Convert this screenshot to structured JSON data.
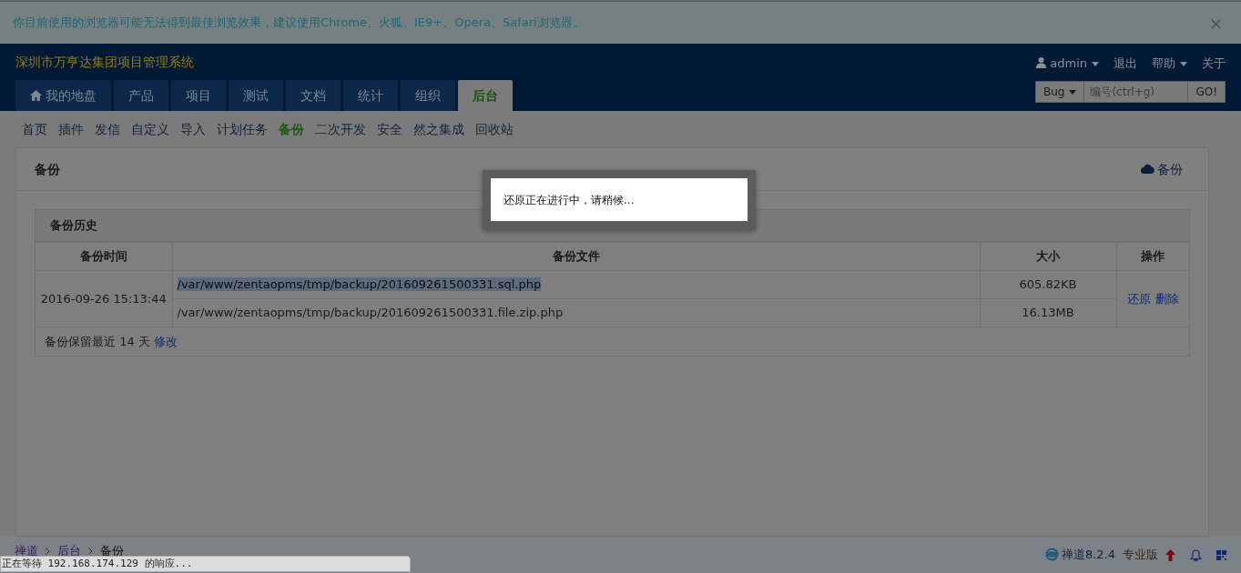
{
  "alert": {
    "text": "你目前使用的浏览器可能无法得到最佳浏览效果，建议使用Chrome、火狐、IE9+、Opera、Safari浏览器。",
    "close": "×"
  },
  "header": {
    "brand": "深圳市万亨达集团项目管理系统",
    "user": "admin",
    "links": [
      {
        "label": "退出",
        "dropdown": false
      },
      {
        "label": "帮助",
        "dropdown": true
      },
      {
        "label": "关于",
        "dropdown": false
      }
    ],
    "search": {
      "type": "Bug",
      "placeholder": "编号(ctrl+g)",
      "button": "GO!"
    }
  },
  "tabs": [
    {
      "label": "我的地盘",
      "kind": "home",
      "selected": false
    },
    {
      "label": "产品",
      "kind": "plain",
      "selected": false
    },
    {
      "label": "项目",
      "kind": "plain",
      "selected": false
    },
    {
      "label": "测试",
      "kind": "plain",
      "selected": false
    },
    {
      "label": "文档",
      "kind": "plain",
      "selected": false
    },
    {
      "label": "统计",
      "kind": "plain",
      "selected": false
    },
    {
      "label": "组织",
      "kind": "plain",
      "selected": false
    },
    {
      "label": "后台",
      "kind": "plain",
      "selected": true
    }
  ],
  "subnav": [
    {
      "label": "首页",
      "selected": false
    },
    {
      "label": "插件",
      "selected": false
    },
    {
      "label": "发信",
      "selected": false
    },
    {
      "label": "自定义",
      "selected": false
    },
    {
      "label": "导入",
      "selected": false
    },
    {
      "label": "计划任务",
      "selected": false
    },
    {
      "label": "备份",
      "selected": true
    },
    {
      "label": "二次开发",
      "selected": false
    },
    {
      "label": "安全",
      "selected": false
    },
    {
      "label": "然之集成",
      "selected": false
    },
    {
      "label": "回收站",
      "selected": false
    }
  ],
  "panel": {
    "title": "备份",
    "action": "备份",
    "history": {
      "title": "备份历史",
      "columns": [
        "备份时间",
        "备份文件",
        "大小",
        "操作"
      ],
      "rows": [
        {
          "time": "2016-09-26 15:13:44",
          "files": [
            {
              "path": "/var/www/zentaopms/tmp/backup/201609261500331.sql.php",
              "size": "605.82KB",
              "selected": true
            },
            {
              "path": "/var/www/zentaopms/tmp/backup/201609261500331.file.zip.php",
              "size": "16.13MB",
              "selected": false
            }
          ],
          "actions": [
            "还原",
            "删除"
          ]
        }
      ],
      "footer": {
        "text": "备份保留最近 14 天",
        "link": "修改"
      }
    }
  },
  "modal": {
    "message": "还原正在进行中，请稍候..."
  },
  "breadcrumb": [
    "禅道",
    "后台",
    "备份"
  ],
  "footer": {
    "version": "禅道8.2.4",
    "edition": "专业版"
  },
  "status": "正在等待 192.168.174.129 的响应..."
}
